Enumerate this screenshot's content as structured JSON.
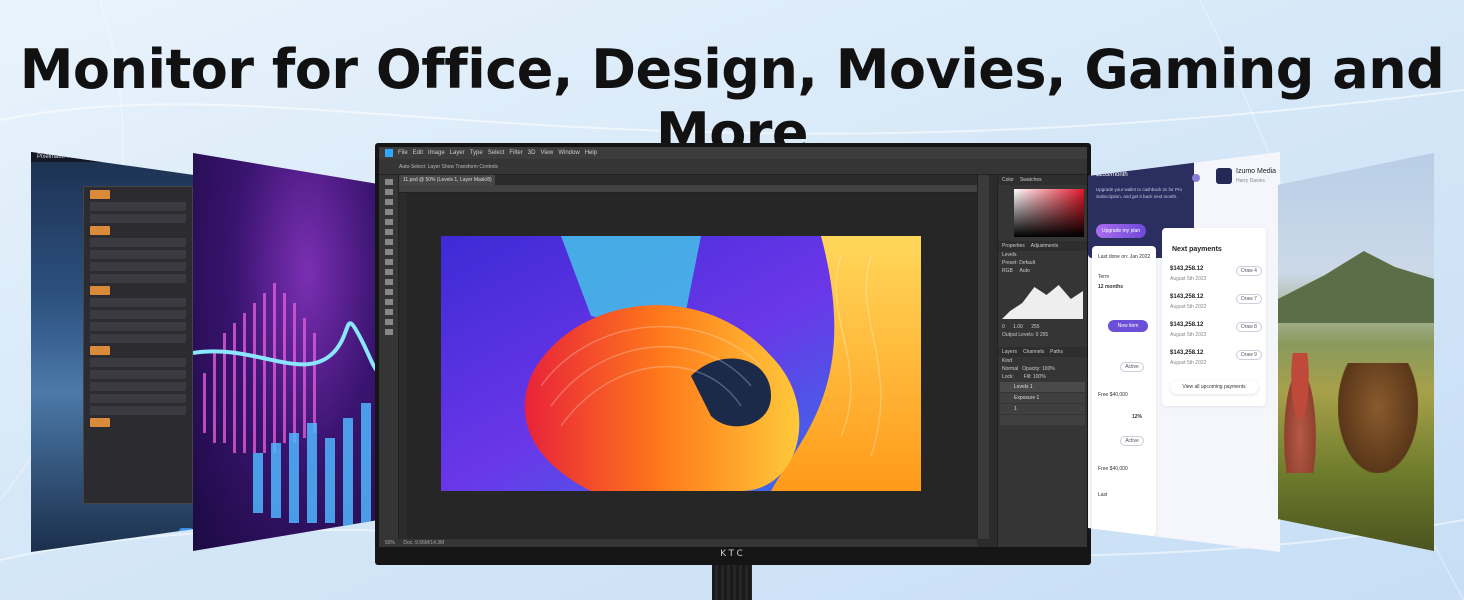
{
  "headline": "Monitor for Office, Design, Movies, Gaming and More",
  "mac_panel": {
    "menubar_text": "Pixelmator Pro"
  },
  "monitor": {
    "brand": "KTC",
    "photoshop": {
      "menu": [
        "File",
        "Edit",
        "Image",
        "Layer",
        "Type",
        "Select",
        "Filter",
        "3D",
        "View",
        "Window",
        "Help"
      ],
      "options_bar": "Auto-Select:  Layer    Show Transform Controls",
      "document_tab": "11.psd @ 50% (Levels 1, Layer Mask/8)",
      "status_zoom": "50%",
      "status_doc": "Doc: 9.66M/14.3M",
      "color_tabs": [
        "Color",
        "Swatches"
      ],
      "properties_tabs": [
        "Properties",
        "Adjustments"
      ],
      "properties_title": "Levels",
      "preset_label": "Preset:",
      "preset_value": "Default",
      "channel": "RGB",
      "channel_auto": "Auto",
      "input_levels": [
        "0",
        "1.00",
        "255"
      ],
      "output_levels_label": "Output Levels:",
      "output_levels": [
        "0",
        "255"
      ],
      "layers_tabs": [
        "Layers",
        "Channels",
        "Paths"
      ],
      "layers_kind": "Kind",
      "blend_mode": "Normal",
      "opacity_label": "Opacity:",
      "opacity": "100%",
      "lock_label": "Lock:",
      "fill_label": "Fill:",
      "fill": "100%",
      "layers": [
        "Levels 1",
        "Exposure 1",
        "1",
        ""
      ]
    }
  },
  "dashboard": {
    "brand_name": "Izumo Media",
    "brand_sub": "Harry Davies",
    "left_card": {
      "lines": [
        "Last done on: Jan 2022",
        "Term",
        "12 months"
      ],
      "new_button": "New item",
      "active_label": "Active",
      "amount_small": "Free $40,000",
      "percent": "12%",
      "active_label_2": "Active",
      "amount_small_2": "Free $40,000",
      "footer": "Last"
    },
    "payments_title": "Next payments",
    "payments": [
      {
        "amount": "$143,258.12",
        "date": "August 5th 2022",
        "action": "Draw 4"
      },
      {
        "amount": "$143,258.12",
        "date": "August 5th 2022",
        "action": "Draw 7"
      },
      {
        "amount": "$143,258.12",
        "date": "August 5th 2022",
        "action": "Draw 8"
      },
      {
        "amount": "$143,258.12",
        "date": "August 5th 2022",
        "action": "Draw 9"
      }
    ],
    "view_all": "View all upcoming payments",
    "upgrade": {
      "title": "Upgrade to Pro",
      "price": "$253/month",
      "description": "Upgrade your wallet to cashback 2x for Pro Subscription, and get it back next month.",
      "button": "Upgrade my plan"
    }
  },
  "colors": {
    "accent_purple": "#6b4fd8",
    "photoshop_blue": "#31a8ff"
  }
}
